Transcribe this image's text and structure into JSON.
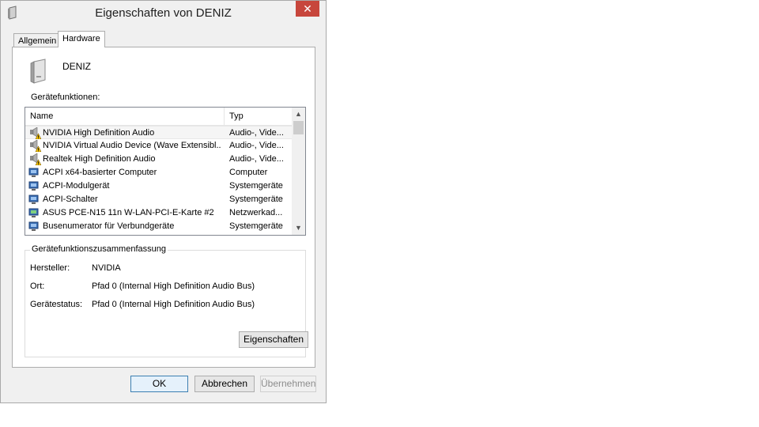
{
  "window": {
    "title": "Eigenschaften von DENIZ",
    "close_glyph": "✕"
  },
  "tabs": [
    {
      "label": "Allgemein"
    },
    {
      "label": "Hardware"
    }
  ],
  "device": {
    "name": "DENIZ"
  },
  "list": {
    "label": "Gerätefunktionen:",
    "columns": {
      "name": "Name",
      "type": "Typ"
    },
    "rows": [
      {
        "name": "NVIDIA High Definition Audio",
        "type": "Audio-, Vide...",
        "icon": "audio-warning-icon",
        "warning": true
      },
      {
        "name": "NVIDIA Virtual Audio Device (Wave Extensibl...",
        "type": "Audio-, Vide...",
        "icon": "audio-warning-icon",
        "warning": true
      },
      {
        "name": "Realtek High Definition Audio",
        "type": "Audio-, Vide...",
        "icon": "audio-warning-icon",
        "warning": true
      },
      {
        "name": "ACPI x64-basierter Computer",
        "type": "Computer",
        "icon": "computer-icon",
        "warning": false
      },
      {
        "name": "ACPI-Modulgerät",
        "type": "Systemgeräte",
        "icon": "system-device-icon",
        "warning": false
      },
      {
        "name": "ACPI-Schalter",
        "type": "Systemgeräte",
        "icon": "system-device-icon",
        "warning": false
      },
      {
        "name": "ASUS PCE-N15 11n W-LAN-PCI-E-Karte #2",
        "type": "Netzwerkad...",
        "icon": "network-adapter-icon",
        "warning": false
      },
      {
        "name": "Busenumerator für Verbundgeräte",
        "type": "Systemgeräte",
        "icon": "system-device-icon",
        "warning": false
      }
    ]
  },
  "summary": {
    "title": "Gerätefunktionszusammenfassung",
    "manufacturer_label": "Hersteller:",
    "manufacturer_value": "NVIDIA",
    "location_label": "Ort:",
    "location_value": "Pfad 0 (Internal High Definition Audio Bus)",
    "status_label": "Gerätestatus:",
    "status_value": "Pfad 0 (Internal High Definition Audio Bus)",
    "properties_button": "Eigenschaften"
  },
  "footer": {
    "ok": "OK",
    "cancel": "Abbrechen",
    "apply": "Übernehmen"
  }
}
